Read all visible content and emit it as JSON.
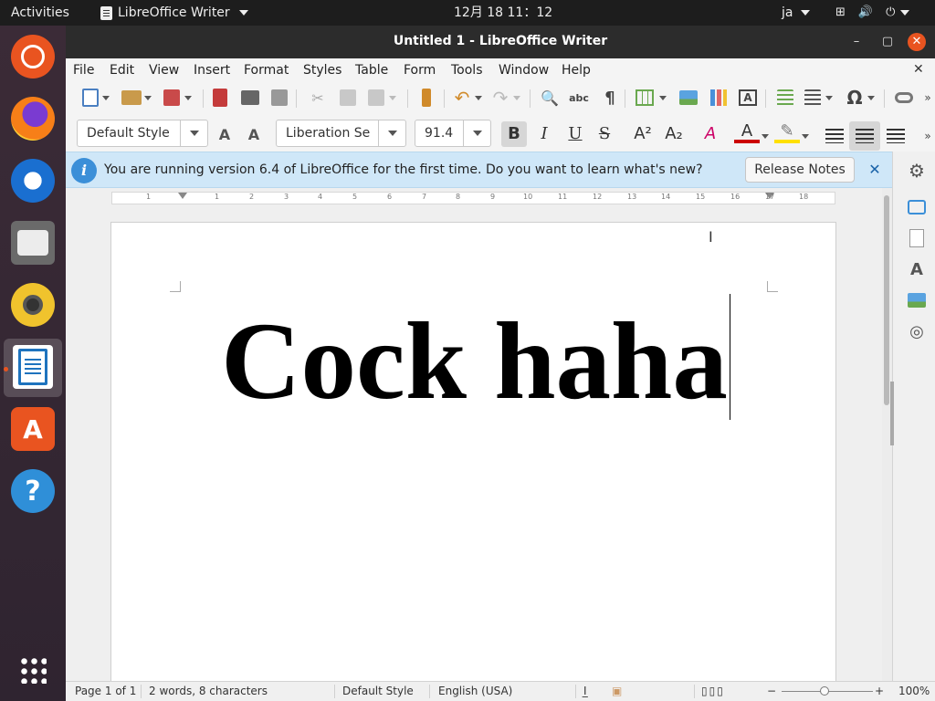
{
  "topbar": {
    "activities": "Activities",
    "app_name": "LibreOffice Writer",
    "clock": "12月 18  11：12",
    "input_method": "ja"
  },
  "window": {
    "title": "Untitled 1 - LibreOffice Writer",
    "minimize": "–",
    "maximize": "▢",
    "close": "✕"
  },
  "menubar": {
    "items": [
      "File",
      "Edit",
      "View",
      "Insert",
      "Format",
      "Styles",
      "Table",
      "Form",
      "Tools",
      "Window",
      "Help"
    ],
    "doc_close": "✕"
  },
  "formatting": {
    "paragraph_style": "Default Style",
    "font_name": "Liberation Se",
    "font_size": "91.4",
    "bold_active": true
  },
  "infobar": {
    "message": "You are running version 6.4 of LibreOffice for the first time. Do you want to learn what's new?",
    "button": "Release Notes",
    "close": "✕"
  },
  "ruler": {
    "ticks": [
      "1",
      "1",
      "2",
      "3",
      "4",
      "5",
      "6",
      "7",
      "8",
      "9",
      "10",
      "11",
      "12",
      "13",
      "14",
      "15",
      "16",
      "17",
      "18"
    ]
  },
  "document": {
    "text": "Cock haha"
  },
  "statusbar": {
    "page": "Page 1 of 1",
    "word_count": "2 words, 8 characters",
    "page_style": "Default Style",
    "language": "English (USA)",
    "zoom": "100%"
  },
  "colors": {
    "accent": "#e95420",
    "infobar_bg": "#cfe7f8",
    "window_titlebar": "#2c2c2c"
  }
}
